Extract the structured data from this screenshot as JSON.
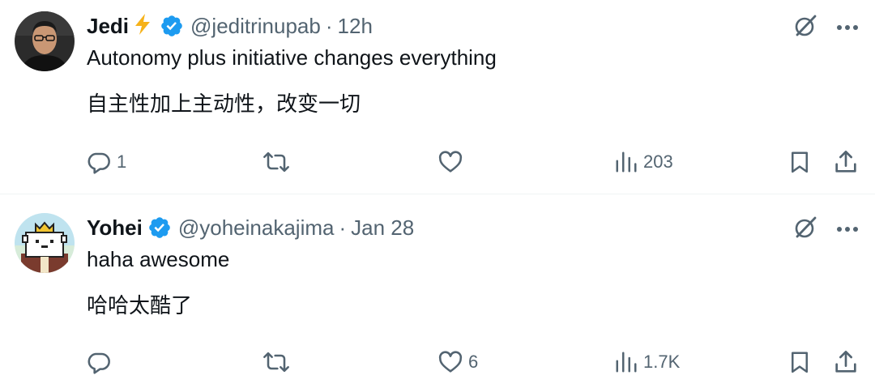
{
  "tweets": [
    {
      "author": {
        "name": "Jedi",
        "emoji": "⚡",
        "handle": "@jeditrinupab",
        "time": "12h"
      },
      "text_en": "Autonomy plus initiative changes everything",
      "text_zh": "自主性加上主动性，改变一切",
      "stats": {
        "replies": "1",
        "retweets": "",
        "likes": "",
        "views": "203"
      }
    },
    {
      "author": {
        "name": "Yohei",
        "handle": "@yoheinakajima",
        "time": "Jan 28"
      },
      "text_en": "haha awesome",
      "text_zh": "哈哈太酷了",
      "stats": {
        "replies": "",
        "retweets": "",
        "likes": "6",
        "views": "1.7K"
      }
    }
  ],
  "separator": "·",
  "colors": {
    "verified": "#1d9bf0",
    "muted": "#536471",
    "text": "#0f1419",
    "divider": "#eff3f4"
  },
  "icons": [
    "verified-badge-icon",
    "grok-icon",
    "more-icon",
    "reply-icon",
    "retweet-icon",
    "like-icon",
    "views-icon",
    "bookmark-icon",
    "share-icon"
  ]
}
